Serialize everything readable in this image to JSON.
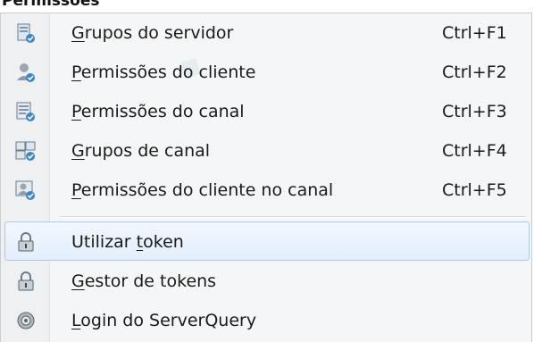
{
  "menu_title": "Permissões",
  "items": [
    {
      "pre": "",
      "key": "G",
      "post": "rupos do servidor",
      "shortcut": "Ctrl+F1",
      "icon": "server-groups-icon"
    },
    {
      "pre": "",
      "key": "P",
      "post": "ermissões do cliente",
      "shortcut": "Ctrl+F2",
      "icon": "client-permissions-icon"
    },
    {
      "pre": "",
      "key": "P",
      "post": "ermissões do canal",
      "shortcut": "Ctrl+F3",
      "icon": "channel-permissions-icon"
    },
    {
      "pre": "",
      "key": "G",
      "post": "rupos de canal",
      "shortcut": "Ctrl+F4",
      "icon": "channel-groups-icon"
    },
    {
      "pre": "",
      "key": "P",
      "post": "ermissões do cliente no canal",
      "shortcut": "Ctrl+F5",
      "icon": "channel-client-permissions-icon"
    },
    {
      "pre": "Utilizar ",
      "key": "t",
      "post": "oken",
      "shortcut": "",
      "icon": "lock-token-icon"
    },
    {
      "pre": "",
      "key": "G",
      "post": "estor de tokens",
      "shortcut": "",
      "icon": "lock-token-manager-icon"
    },
    {
      "pre": "",
      "key": "L",
      "post": "ogin do ServerQuery",
      "shortcut": "",
      "icon": "serverquery-login-icon"
    }
  ],
  "colors": {
    "highlight_border": "#a8c8ec",
    "highlight_bg": "#e3effb",
    "menu_bg": "#f5f6f7"
  }
}
